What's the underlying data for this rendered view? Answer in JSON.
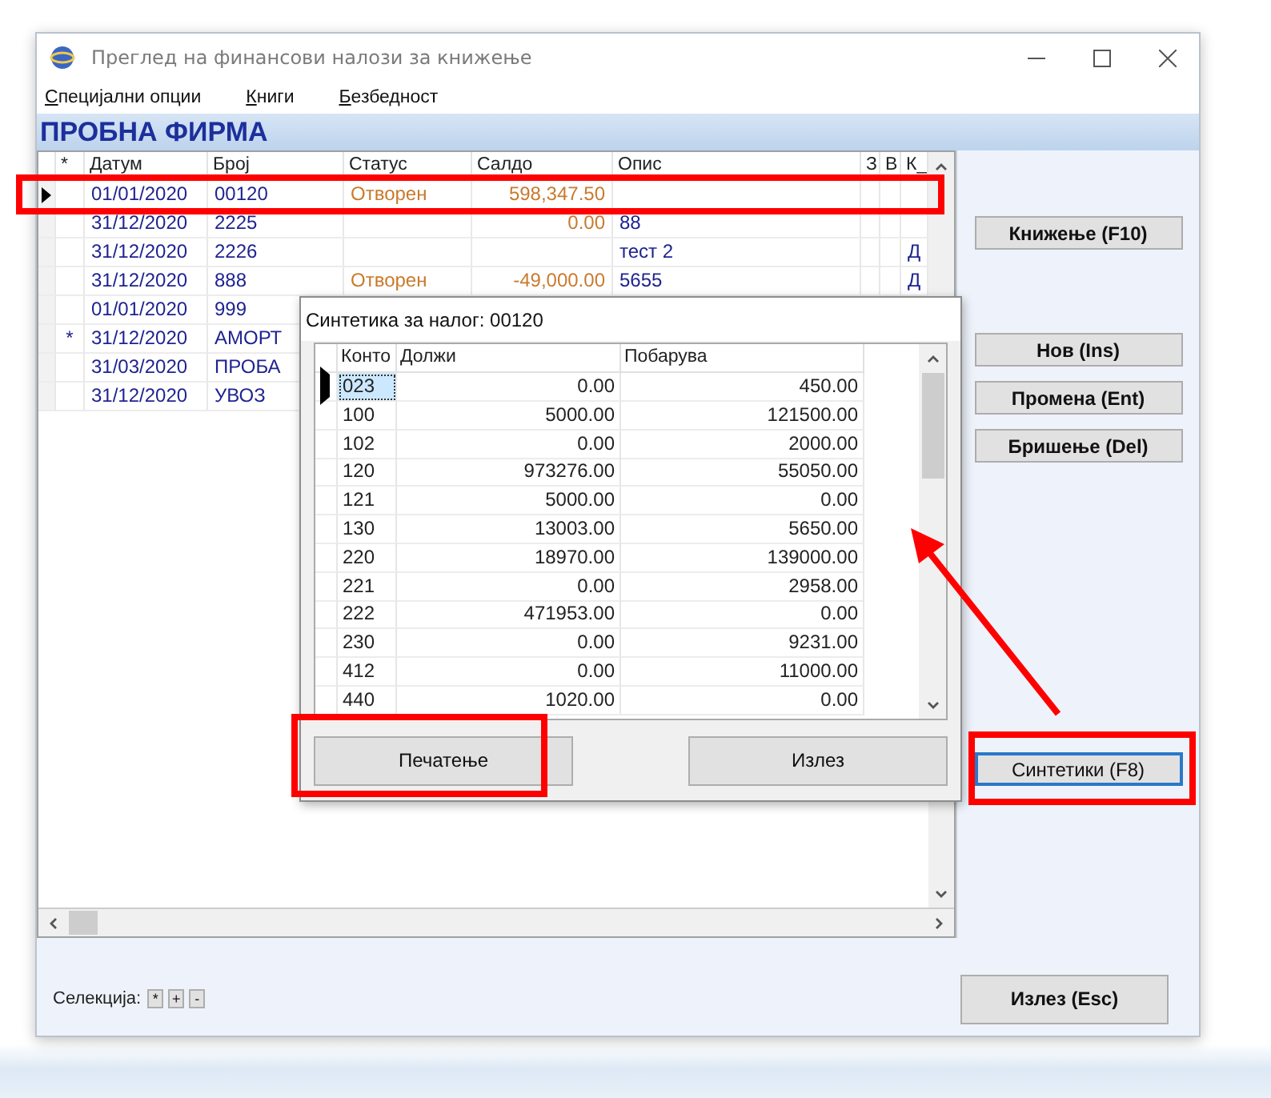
{
  "window": {
    "title": "Преглед на финансови налози за книжење"
  },
  "menu": [
    "Специјални опции",
    "Книги",
    "Безбедност"
  ],
  "company": "ПРОБНА ФИРМА",
  "table": {
    "columns": [
      "*",
      "Датум",
      "Број",
      "Статус",
      "Салдо",
      "Опис",
      "З",
      "В",
      "К_"
    ],
    "rows": [
      {
        "selected": true,
        "date": "01/01/2020",
        "number": "00120",
        "status": "Отворен",
        "balance": "598,347.50"
      },
      {
        "selected": false,
        "date": "31/12/2020",
        "number": "2225",
        "balance": "0.00",
        "description": "88"
      },
      {
        "selected": false,
        "date": "31/12/2020",
        "number": "2226",
        "description": "тест 2",
        "k": "Д"
      },
      {
        "selected": false,
        "date": "31/12/2020",
        "number": "888",
        "status": "Отворен",
        "balance": "-49,000.00",
        "description": "5655",
        "k": "Д"
      },
      {
        "selected": false,
        "date": "01/01/2020",
        "number": "999"
      },
      {
        "selected": false,
        "flag": "*",
        "date": "31/12/2020",
        "number": "АМОРТ"
      },
      {
        "selected": false,
        "date": "31/03/2020",
        "number": "ПРОБА"
      },
      {
        "selected": false,
        "date": "31/12/2020",
        "number": "УВОЗ"
      }
    ]
  },
  "dialog": {
    "title": "Синтетика за налог:  00120",
    "columns": [
      "Конто",
      "Должи",
      "Побарува"
    ],
    "rows": [
      {
        "selected": true,
        "account": "023",
        "debit": "0.00",
        "credit": "450.00"
      },
      {
        "selected": false,
        "account": "100",
        "debit": "5000.00",
        "credit": "121500.00"
      },
      {
        "selected": false,
        "account": "102",
        "debit": "0.00",
        "credit": "2000.00"
      },
      {
        "selected": false,
        "account": "120",
        "debit": "973276.00",
        "credit": "55050.00"
      },
      {
        "selected": false,
        "account": "121",
        "debit": "5000.00",
        "credit": "0.00"
      },
      {
        "selected": false,
        "account": "130",
        "debit": "13003.00",
        "credit": "5650.00"
      },
      {
        "selected": false,
        "account": "220",
        "debit": "18970.00",
        "credit": "139000.00"
      },
      {
        "selected": false,
        "account": "221",
        "debit": "0.00",
        "credit": "2958.00"
      },
      {
        "selected": false,
        "account": "222",
        "debit": "471953.00",
        "credit": "0.00"
      },
      {
        "selected": false,
        "account": "230",
        "debit": "0.00",
        "credit": "9231.00"
      },
      {
        "selected": false,
        "account": "412",
        "debit": "0.00",
        "credit": "11000.00"
      },
      {
        "selected": false,
        "account": "440",
        "debit": "1020.00",
        "credit": "0.00"
      }
    ],
    "buttons": [
      "Печатење",
      "Излез"
    ]
  },
  "side_buttons": [
    [
      {
        "label": "Книжење (F10)",
        "kind": "bold",
        "focused": false
      }
    ],
    [
      {
        "label": "Нов (Ins)",
        "kind": "bold",
        "focused": false
      },
      {
        "label": "Промена (Ent)",
        "kind": "bold",
        "focused": false
      },
      {
        "label": "Бришење (Del)",
        "kind": "bold",
        "focused": false
      }
    ],
    [
      {
        "label": "Синтетики (F8)",
        "kind": "plain",
        "focused": true
      }
    ]
  ],
  "selection": {
    "label": "Селекција:",
    "buttons": [
      "*",
      "+",
      "-"
    ]
  },
  "exit_button": "Излез (Esc)"
}
